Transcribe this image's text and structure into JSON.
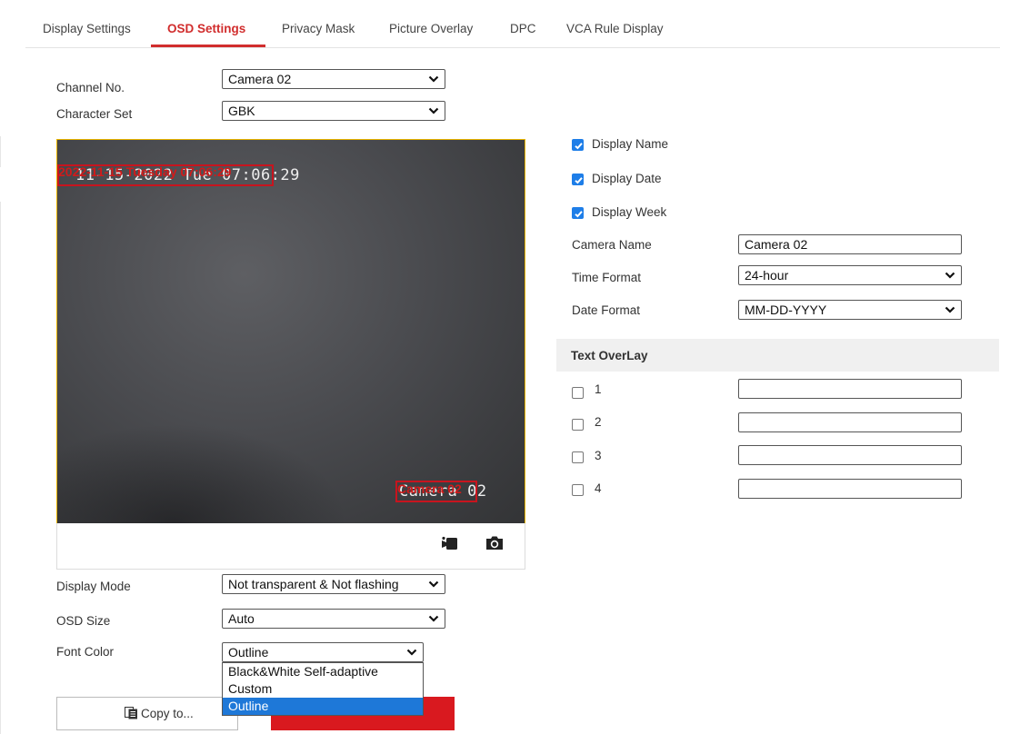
{
  "tabs": [
    {
      "label": "Display Settings"
    },
    {
      "label": "OSD Settings"
    },
    {
      "label": "Privacy Mask"
    },
    {
      "label": "Picture Overlay"
    },
    {
      "label": "DPC"
    },
    {
      "label": "VCA Rule Display"
    }
  ],
  "form": {
    "channel_label": "Channel No.",
    "channel_value": "Camera 02",
    "charset_label": "Character Set",
    "charset_value": "GBK",
    "display_mode_label": "Display Mode",
    "display_mode_value": "Not transparent & Not flashing",
    "osd_size_label": "OSD Size",
    "osd_size_value": "Auto",
    "font_color_label": "Font Color",
    "font_color_value": "Outline",
    "font_color_options": [
      "Black&White Self-adaptive",
      "Custom",
      "Outline"
    ],
    "font_color_selected_index": 2
  },
  "preview": {
    "osd_datetime": "11-15-2022 Tue 07:06:29",
    "osd_date_overlay": "2022-11-15 Tuesday 07:06:29",
    "osd_camera_name": "Camera 02",
    "osd_camera_overlay": "Camera 02",
    "record_icon": "video-record-icon",
    "snapshot_icon": "camera-icon"
  },
  "options": {
    "display_name": {
      "label": "Display Name",
      "checked": true
    },
    "display_date": {
      "label": "Display Date",
      "checked": true
    },
    "display_week": {
      "label": "Display Week",
      "checked": true
    },
    "camera_name_label": "Camera Name",
    "camera_name_value": "Camera 02",
    "time_format_label": "Time Format",
    "time_format_value": "24-hour",
    "date_format_label": "Date Format",
    "date_format_value": "MM-DD-YYYY"
  },
  "text_overlay": {
    "title": "Text OverLay",
    "items": [
      {
        "label": "1",
        "checked": false,
        "value": ""
      },
      {
        "label": "2",
        "checked": false,
        "value": ""
      },
      {
        "label": "3",
        "checked": false,
        "value": ""
      },
      {
        "label": "4",
        "checked": false,
        "value": ""
      }
    ]
  },
  "buttons": {
    "copy_label": "Copy to...",
    "copy_icon": "copy-icon",
    "save_label": ""
  },
  "colors": {
    "accent": "#d12d2d",
    "checkbox": "#1e7ee8",
    "highlight": "#1e78d8",
    "preview_border": "#e8b400"
  }
}
